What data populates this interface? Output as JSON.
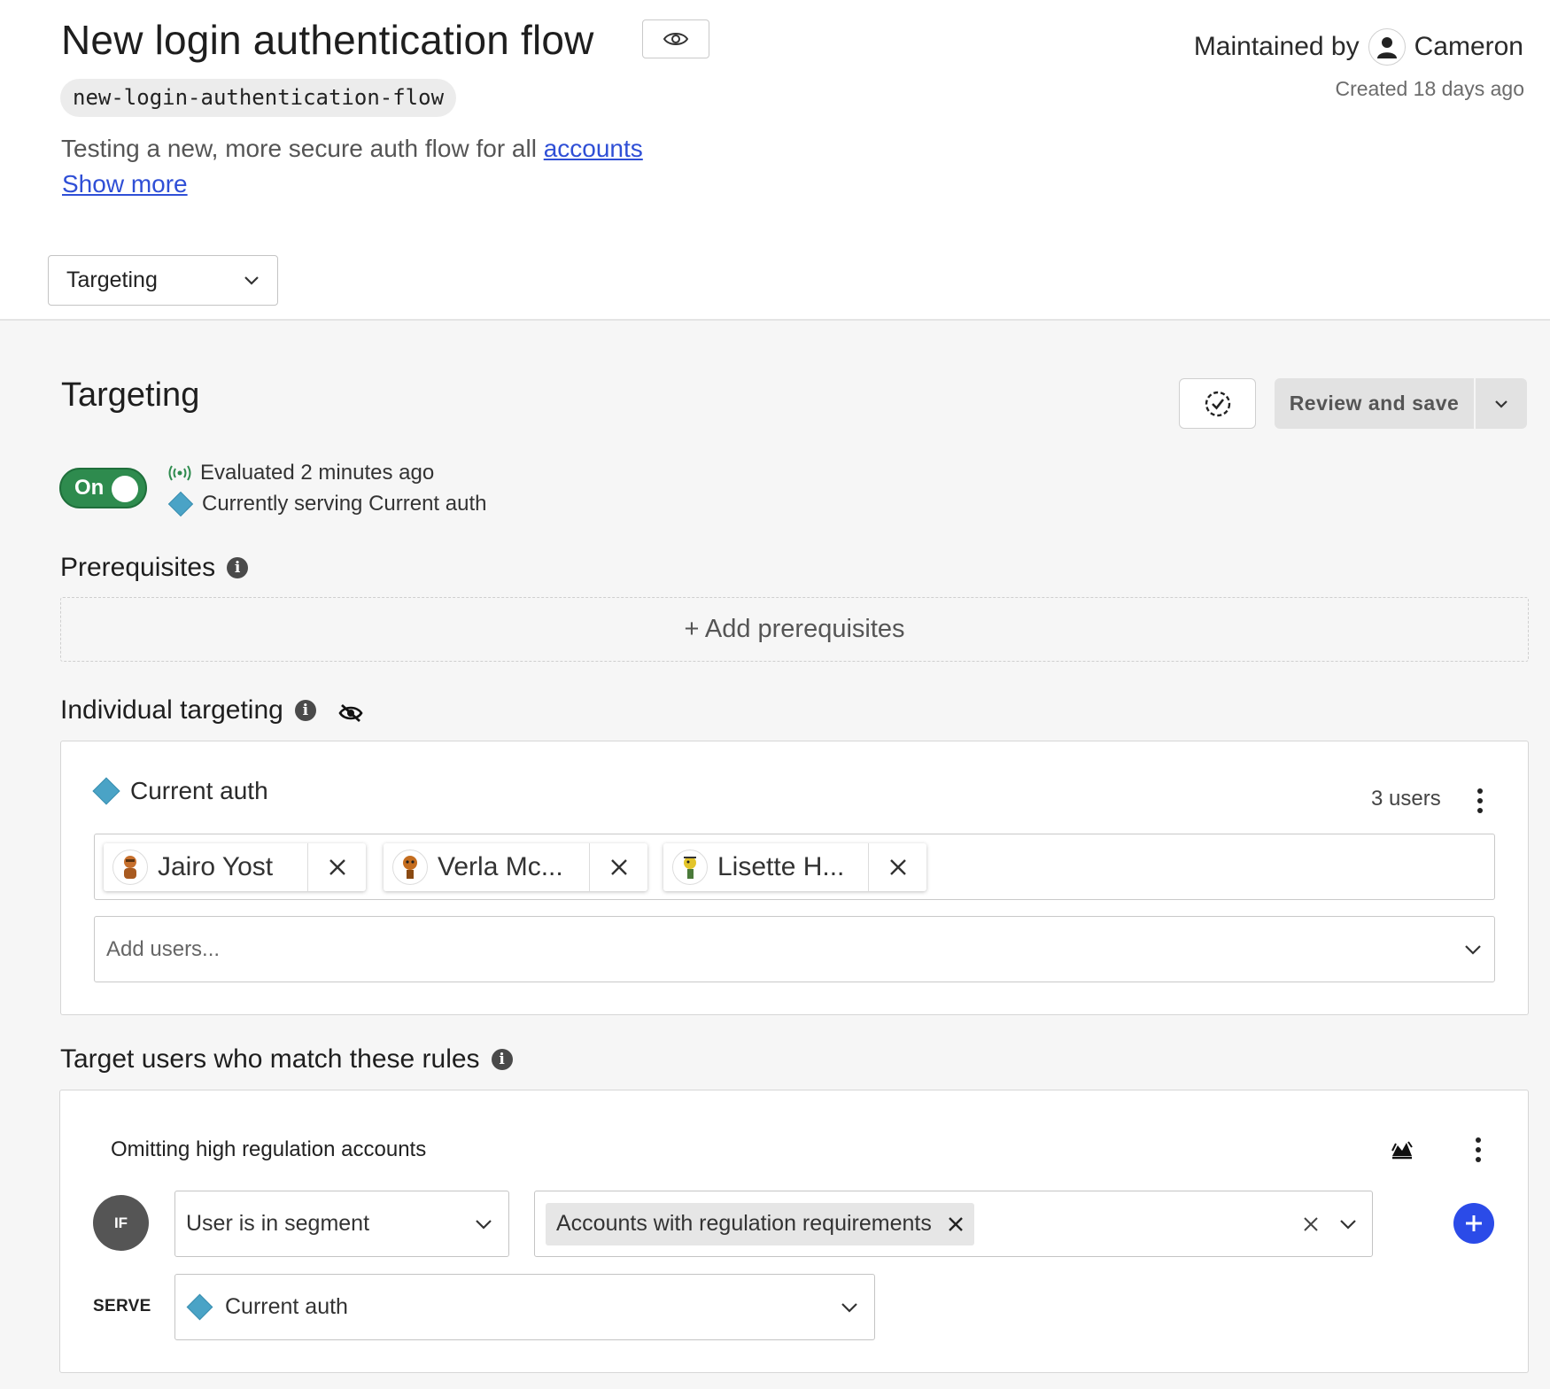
{
  "flag": {
    "title": "New login authentication flow",
    "key": "new-login-authentication-flow",
    "description_prefix": "Testing a new, more secure auth flow for all",
    "description_link": "accounts",
    "show_more": "Show more",
    "maintained_by_label": "Maintained by",
    "maintainer": "Cameron",
    "created": "Created 18 days ago"
  },
  "view_select": {
    "value": "Targeting"
  },
  "targeting": {
    "title": "Targeting",
    "review_save_label": "Review and save",
    "toggle_label": "On",
    "evaluated": "Evaluated 2 minutes ago",
    "serving": "Currently serving Current auth"
  },
  "prerequisites": {
    "title": "Prerequisites",
    "add_label": "+ Add prerequisites"
  },
  "individual": {
    "title": "Individual targeting",
    "variation": "Current auth",
    "users_count": "3 users",
    "users": [
      {
        "name": "Jairo Yost"
      },
      {
        "name": "Verla Mc..."
      },
      {
        "name": "Lisette H..."
      }
    ],
    "add_placeholder": "Add users..."
  },
  "rules": {
    "title": "Target users who match these rules",
    "rule_name": "Omitting high regulation accounts",
    "if_label": "IF",
    "clause_op": "User is in segment",
    "segment": "Accounts with regulation requirements",
    "serve_label": "SERVE",
    "serve_value": "Current auth"
  },
  "colors": {
    "accent": "#2b4be8",
    "toggle_on": "#2e8b4e",
    "variation": "#4aa3c6",
    "link": "#2f4fd6"
  }
}
